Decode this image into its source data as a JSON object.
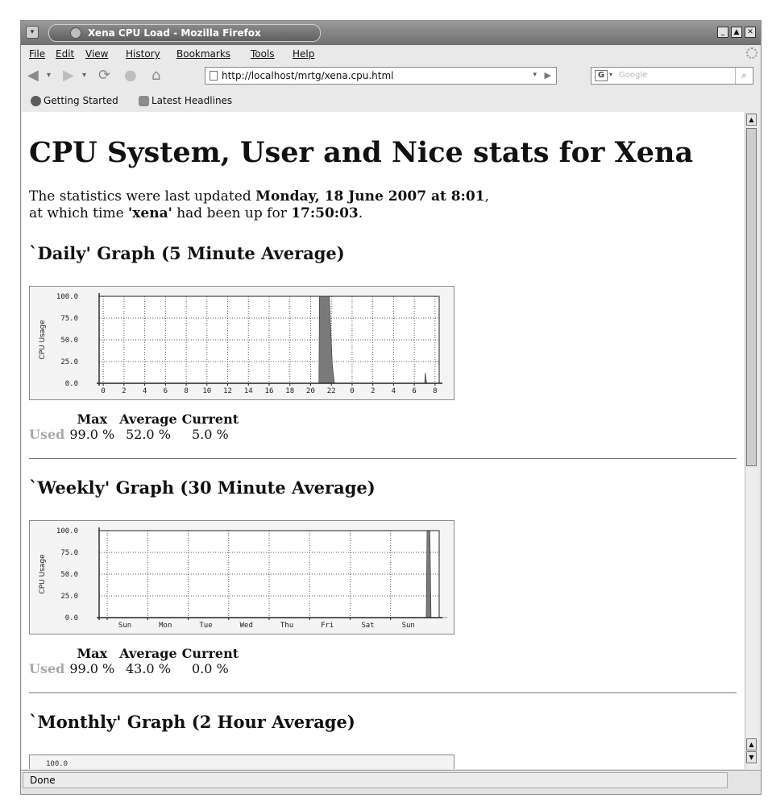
{
  "window": {
    "title": "Xena CPU Load - Mozilla Firefox",
    "controls": [
      "minimize",
      "maximize",
      "close"
    ]
  },
  "menu": [
    "File",
    "Edit",
    "View",
    "History",
    "Bookmarks",
    "Tools",
    "Help"
  ],
  "toolbar": {
    "url": "http://localhost/mrtg/xena.cpu.html",
    "search_placeholder": "Google",
    "search_engine": "G"
  },
  "bookmarks": [
    "Getting Started",
    "Latest Headlines"
  ],
  "page": {
    "title": "CPU System, User and Nice stats for Xena",
    "status_prefix": "The statistics were last updated ",
    "updated": "Monday, 18 June 2007 at 8:01",
    "status_mid_1": ",",
    "status_mid_2": "at which time ",
    "host": "'xena'",
    "status_mid_3": " had been up for ",
    "uptime": "17:50:03",
    "status_end": "."
  },
  "sections": [
    {
      "title": "`Daily' Graph (5 Minute Average)",
      "stats": {
        "headers": [
          "Max",
          "Average",
          "Current"
        ],
        "row_label": "Used",
        "values": [
          "99.0 %",
          "52.0 %",
          "5.0 %"
        ]
      }
    },
    {
      "title": "`Weekly' Graph (30 Minute Average)",
      "stats": {
        "headers": [
          "Max",
          "Average",
          "Current"
        ],
        "row_label": "Used",
        "values": [
          "99.0 %",
          "43.0 %",
          "0.0 %"
        ]
      }
    },
    {
      "title": "`Monthly' Graph (2 Hour Average)",
      "peek_tick": "100.0"
    }
  ],
  "chart_data": [
    {
      "type": "area",
      "ylabel": "CPU Usage",
      "ylim": [
        0,
        100
      ],
      "yticks": [
        "0.0",
        "25.0",
        "50.0",
        "75.0",
        "100.0"
      ],
      "xticks": [
        "0",
        "2",
        "4",
        "6",
        "8",
        "10",
        "12",
        "14",
        "16",
        "18",
        "20",
        "22",
        "0",
        "2",
        "4",
        "6",
        "8"
      ],
      "series": [
        {
          "x": [
            0,
            20.8,
            20.85,
            21.8,
            22.1,
            22.3,
            31.0,
            31.05,
            31.2,
            32.0
          ],
          "values": [
            0,
            0,
            100,
            100,
            20,
            0,
            0,
            12,
            0,
            0
          ]
        }
      ]
    },
    {
      "type": "area",
      "ylabel": "CPU Usage",
      "ylim": [
        0,
        100
      ],
      "yticks": [
        "0.0",
        "25.0",
        "50.0",
        "75.0",
        "100.0"
      ],
      "xticks": [
        "Sun",
        "Mon",
        "Tue",
        "Wed",
        "Thu",
        "Fri",
        "Sat",
        "Sun"
      ],
      "series": [
        {
          "x": [
            0,
            7.88,
            7.9,
            7.97,
            8.0,
            8.4
          ],
          "values": [
            0,
            0,
            100,
            100,
            0,
            0
          ]
        }
      ]
    }
  ],
  "statusbar": {
    "text": "Done"
  },
  "colors": {
    "chart_fill": "#7a7a7a",
    "used_label": "#a8a8a8"
  }
}
